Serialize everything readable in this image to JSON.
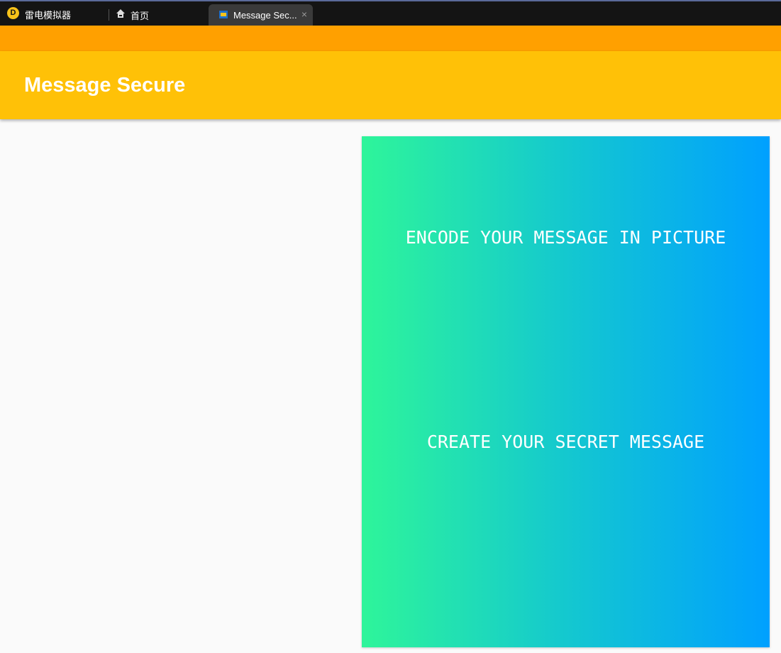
{
  "titlebar": {
    "app_name": "雷电模拟器",
    "home_label": "首页",
    "tab_label": "Message Sec...",
    "close": "×",
    "logo": "D"
  },
  "appbar": {
    "title": "Message Secure"
  },
  "main": {
    "encode_button": "ENCODE YOUR MESSAGE IN PICTURE",
    "create_button": "CREATE YOUR SECRET MESSAGE"
  },
  "colors": {
    "status": "#ffa000",
    "appbar": "#ffc107",
    "gradient_start": "#2ef59a",
    "gradient_end": "#00a0ff"
  }
}
